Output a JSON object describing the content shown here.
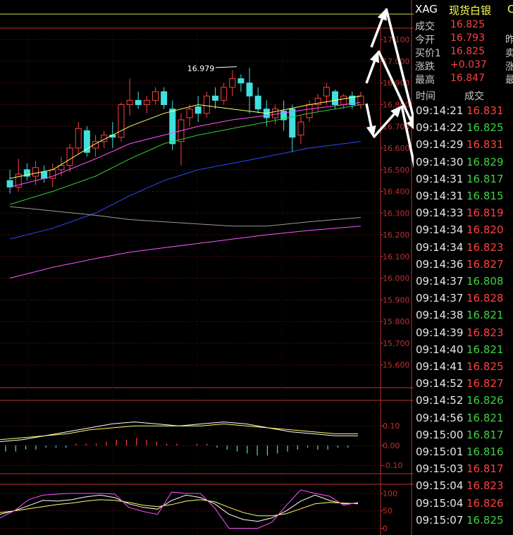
{
  "quote": {
    "symbol": "XAG",
    "name": "现货白银",
    "name_overflow": "C",
    "rows": [
      {
        "label": "成交",
        "value": "16.825",
        "right": ""
      },
      {
        "label": "今开",
        "value": "16.793",
        "right": "昨"
      },
      {
        "label": "买价1",
        "value": "16.825",
        "right": "卖"
      },
      {
        "label": "涨跌",
        "value": "+0.037",
        "right": "涨"
      },
      {
        "label": "最高",
        "value": "16.847",
        "right": "最"
      }
    ],
    "tick_header": {
      "time": "时间",
      "price": "成交"
    },
    "ticks": [
      {
        "time": "09:14:21",
        "price": "16.831"
      },
      {
        "time": "09:14:22",
        "price": "16.825"
      },
      {
        "time": "09:14:29",
        "price": "16.831"
      },
      {
        "time": "09:14:30",
        "price": "16.829"
      },
      {
        "time": "09:14:31",
        "price": "16.817"
      },
      {
        "time": "09:14:31",
        "price": "16.815"
      },
      {
        "time": "09:14:33",
        "price": "16.819"
      },
      {
        "time": "09:14:34",
        "price": "16.820"
      },
      {
        "time": "09:14:34",
        "price": "16.823"
      },
      {
        "time": "09:14:36",
        "price": "16.827"
      },
      {
        "time": "09:14:37",
        "price": "16.808"
      },
      {
        "time": "09:14:37",
        "price": "16.828"
      },
      {
        "time": "09:14:38",
        "price": "16.821"
      },
      {
        "time": "09:14:39",
        "price": "16.823"
      },
      {
        "time": "09:14:40",
        "price": "16.821"
      },
      {
        "time": "09:14:41",
        "price": "16.825"
      },
      {
        "time": "09:14:52",
        "price": "16.827"
      },
      {
        "time": "09:14:52",
        "price": "16.826"
      },
      {
        "time": "09:14:56",
        "price": "16.821"
      },
      {
        "time": "09:15:00",
        "price": "16.817"
      },
      {
        "time": "09:15:01",
        "price": "16.816"
      },
      {
        "time": "09:15:03",
        "price": "16.817"
      },
      {
        "time": "09:15:04",
        "price": "16.823"
      },
      {
        "time": "09:15:04",
        "price": "16.826"
      },
      {
        "time": "09:15:07",
        "price": "16.825"
      }
    ]
  },
  "colors": {
    "up": "#ff4040",
    "down": "#40e0e0",
    "grid": "#8a1c1c",
    "axis": "#c03030"
  },
  "chart_data": [
    {
      "type": "candlestick",
      "yticks": [
        "17.100",
        "17.000",
        "16.900",
        "16.800",
        "16.700",
        "16.600",
        "16.500",
        "16.400",
        "16.300",
        "16.200",
        "16.100",
        "16.000",
        "15.900",
        "15.800",
        "15.700",
        "15.600"
      ],
      "ylim": [
        15.55,
        17.13
      ],
      "annotation": "16.979",
      "candles": [
        {
          "o": 16.45,
          "h": 16.5,
          "l": 16.39,
          "c": 16.42
        },
        {
          "o": 16.42,
          "h": 16.55,
          "l": 16.4,
          "c": 16.48
        },
        {
          "o": 16.5,
          "h": 16.53,
          "l": 16.45,
          "c": 16.47
        },
        {
          "o": 16.47,
          "h": 16.54,
          "l": 16.43,
          "c": 16.51
        },
        {
          "o": 16.49,
          "h": 16.52,
          "l": 16.44,
          "c": 16.46
        },
        {
          "o": 16.46,
          "h": 16.53,
          "l": 16.42,
          "c": 16.5
        },
        {
          "o": 16.5,
          "h": 16.56,
          "l": 16.47,
          "c": 16.52
        },
        {
          "o": 16.52,
          "h": 16.62,
          "l": 16.49,
          "c": 16.6
        },
        {
          "o": 16.6,
          "h": 16.72,
          "l": 16.57,
          "c": 16.69
        },
        {
          "o": 16.68,
          "h": 16.7,
          "l": 16.56,
          "c": 16.58
        },
        {
          "o": 16.6,
          "h": 16.66,
          "l": 16.56,
          "c": 16.63
        },
        {
          "o": 16.63,
          "h": 16.68,
          "l": 16.6,
          "c": 16.66
        },
        {
          "o": 16.66,
          "h": 16.72,
          "l": 16.6,
          "c": 16.65
        },
        {
          "o": 16.65,
          "h": 16.81,
          "l": 16.63,
          "c": 16.8
        },
        {
          "o": 16.8,
          "h": 16.92,
          "l": 16.75,
          "c": 16.82
        },
        {
          "o": 16.82,
          "h": 16.86,
          "l": 16.78,
          "c": 16.8
        },
        {
          "o": 16.8,
          "h": 16.84,
          "l": 16.76,
          "c": 16.82
        },
        {
          "o": 16.82,
          "h": 16.88,
          "l": 16.8,
          "c": 16.86
        },
        {
          "o": 16.86,
          "h": 16.88,
          "l": 16.78,
          "c": 16.8
        },
        {
          "o": 16.78,
          "h": 16.82,
          "l": 16.59,
          "c": 16.62
        },
        {
          "o": 16.63,
          "h": 16.76,
          "l": 16.52,
          "c": 16.73
        },
        {
          "o": 16.74,
          "h": 16.8,
          "l": 16.7,
          "c": 16.78
        },
        {
          "o": 16.79,
          "h": 16.84,
          "l": 16.72,
          "c": 16.76
        },
        {
          "o": 16.76,
          "h": 16.86,
          "l": 16.74,
          "c": 16.84
        },
        {
          "o": 16.84,
          "h": 16.88,
          "l": 16.78,
          "c": 16.82
        },
        {
          "o": 16.82,
          "h": 16.9,
          "l": 16.8,
          "c": 16.88
        },
        {
          "o": 16.88,
          "h": 16.96,
          "l": 16.84,
          "c": 16.92
        },
        {
          "o": 16.92,
          "h": 16.94,
          "l": 16.86,
          "c": 16.9
        },
        {
          "o": 16.9,
          "h": 16.97,
          "l": 16.76,
          "c": 16.84
        },
        {
          "o": 16.84,
          "h": 16.88,
          "l": 16.76,
          "c": 16.78
        },
        {
          "o": 16.78,
          "h": 16.82,
          "l": 16.7,
          "c": 16.74
        },
        {
          "o": 16.74,
          "h": 16.8,
          "l": 16.71,
          "c": 16.78
        },
        {
          "o": 16.77,
          "h": 16.82,
          "l": 16.68,
          "c": 16.73
        },
        {
          "o": 16.78,
          "h": 16.8,
          "l": 16.58,
          "c": 16.65
        },
        {
          "o": 16.66,
          "h": 16.75,
          "l": 16.62,
          "c": 16.72
        },
        {
          "o": 16.74,
          "h": 16.82,
          "l": 16.72,
          "c": 16.8
        },
        {
          "o": 16.8,
          "h": 16.85,
          "l": 16.77,
          "c": 16.83
        },
        {
          "o": 16.84,
          "h": 16.9,
          "l": 16.8,
          "c": 16.88
        },
        {
          "o": 16.86,
          "h": 16.87,
          "l": 16.78,
          "c": 16.8
        },
        {
          "o": 16.8,
          "h": 16.85,
          "l": 16.78,
          "c": 16.84
        },
        {
          "o": 16.84,
          "h": 16.86,
          "l": 16.78,
          "c": 16.8
        },
        {
          "o": 16.8,
          "h": 16.86,
          "l": 16.78,
          "c": 16.84
        }
      ],
      "ma_lines": [
        {
          "color": "#ffff66",
          "values": [
            [
              16.46,
              16.5,
              16.62,
              16.7,
              16.76,
              16.8,
              16.78,
              16.76,
              16.8,
              16.84
            ],
            [
              0,
              5,
              10,
              14,
              18,
              22,
              26,
              30,
              35,
              41
            ]
          ]
        },
        {
          "color": "#ff55ff",
          "values": [
            [
              16.42,
              16.47,
              16.55,
              16.62,
              16.66,
              16.7,
              16.73,
              16.75,
              16.78,
              16.81
            ],
            [
              0,
              5,
              10,
              14,
              18,
              22,
              26,
              30,
              35,
              41
            ]
          ]
        },
        {
          "color": "#33cc33",
          "values": [
            [
              16.34,
              16.4,
              16.47,
              16.55,
              16.62,
              16.66,
              16.69,
              16.72,
              16.76,
              16.8
            ],
            [
              0,
              5,
              10,
              14,
              18,
              22,
              26,
              30,
              35,
              41
            ]
          ]
        },
        {
          "color": "#2a4cff",
          "values": [
            [
              16.18,
              16.23,
              16.3,
              16.38,
              16.45,
              16.5,
              16.53,
              16.56,
              16.6,
              16.63
            ],
            [
              0,
              5,
              10,
              14,
              18,
              22,
              26,
              30,
              35,
              41
            ]
          ]
        },
        {
          "color": "#9a9a9a",
          "values": [
            [
              16.33,
              16.31,
              16.29,
              16.27,
              16.26,
              16.25,
              16.24,
              16.24,
              16.26,
              16.28
            ],
            [
              0,
              5,
              10,
              14,
              18,
              22,
              26,
              30,
              35,
              41
            ]
          ]
        },
        {
          "color": "#ff55ff",
          "values": [
            [
              16.0,
              16.05,
              16.09,
              16.12,
              16.14,
              16.16,
              16.18,
              16.2,
              16.22,
              16.24
            ],
            [
              0,
              5,
              10,
              14,
              18,
              22,
              26,
              30,
              35,
              41
            ]
          ]
        }
      ]
    },
    {
      "type": "macd",
      "yticks": [
        "0.10",
        "0.00",
        "-0.10"
      ],
      "ylim": [
        -0.11,
        0.14
      ],
      "dif": [
        0.02,
        0.03,
        0.05,
        0.07,
        0.09,
        0.11,
        0.12,
        0.11,
        0.1,
        0.11,
        0.12,
        0.11,
        0.09,
        0.07,
        0.06,
        0.05,
        0.05
      ],
      "dea": [
        0.03,
        0.04,
        0.05,
        0.06,
        0.08,
        0.09,
        0.1,
        0.1,
        0.1,
        0.1,
        0.11,
        0.1,
        0.09,
        0.08,
        0.07,
        0.06,
        0.06
      ],
      "bars": [
        -0.03,
        -0.03,
        -0.02,
        -0.02,
        -0.01,
        -0.01,
        -0.01,
        0.01,
        0.01,
        0.01,
        0.02,
        0.03,
        0.03,
        0.04,
        0.03,
        0.02,
        0.01,
        0.01,
        0.0,
        0.01,
        0.01,
        -0.01,
        -0.02,
        -0.03,
        -0.04,
        -0.05,
        -0.05,
        -0.04,
        -0.03,
        -0.02,
        -0.01,
        -0.02,
        -0.02,
        -0.01,
        -0.01
      ]
    },
    {
      "type": "oscillator",
      "yticks": [
        "100",
        "50",
        "0"
      ],
      "ylim": [
        -5,
        110
      ],
      "k": [
        40,
        50,
        65,
        80,
        78,
        82,
        90,
        95,
        88,
        70,
        60,
        55,
        80,
        95,
        88,
        70,
        40,
        25,
        20,
        30,
        50,
        78,
        95,
        80,
        70,
        72
      ],
      "d": [
        45,
        50,
        56,
        62,
        68,
        72,
        78,
        82,
        80,
        74,
        66,
        62,
        68,
        78,
        82,
        76,
        60,
        45,
        36,
        36,
        42,
        56,
        70,
        74,
        72,
        70
      ],
      "j": [
        30,
        50,
        82,
        95,
        98,
        100,
        100,
        100,
        98,
        60,
        48,
        40,
        104,
        100,
        100,
        58,
        0,
        0,
        0,
        18,
        66,
        110,
        100,
        92,
        66,
        74
      ]
    }
  ]
}
